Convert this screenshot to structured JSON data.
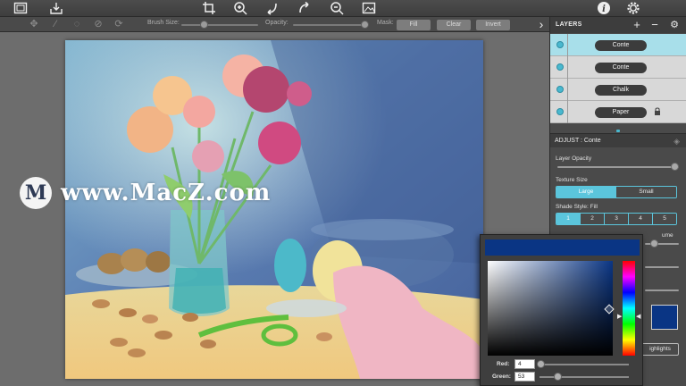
{
  "toolbar": {
    "buttons": [
      {
        "name": "gallery-icon",
        "glyph": "▣"
      },
      {
        "name": "save-tray-icon",
        "glyph": "⇩"
      },
      {
        "name": "crop-icon",
        "glyph": "⌗"
      },
      {
        "name": "zoom-in-icon",
        "glyph": "⊕"
      },
      {
        "name": "undo-icon",
        "glyph": "↶"
      },
      {
        "name": "redo-icon",
        "glyph": "↷"
      },
      {
        "name": "zoom-out-icon",
        "glyph": "⊖"
      },
      {
        "name": "image-icon",
        "glyph": "▨"
      },
      {
        "name": "info-icon",
        "glyph": "i"
      },
      {
        "name": "settings-icon",
        "glyph": "⚙"
      }
    ]
  },
  "subbar": {
    "tool_glyphs": [
      "✥",
      "⁄",
      "◌",
      "⊘",
      "⟳"
    ],
    "brush_size_label": "Brush Size:",
    "brush_size_value": 0.3,
    "opacity_label": "Opacity:",
    "opacity_value": 0.97,
    "mask_label": "Mask:",
    "fill_label": "Fill",
    "clear_label": "Clear",
    "invert_label": "Invert",
    "panel_toggle_glyph": "›"
  },
  "watermark": {
    "logo_letter": "M",
    "text": "www.MacZ.com"
  },
  "layers": {
    "title": "LAYERS",
    "add_glyph": "+",
    "remove_glyph": "−",
    "options_glyph": "⚙",
    "items": [
      {
        "label": "Conte",
        "selected": true,
        "locked": false
      },
      {
        "label": "Conte",
        "selected": false,
        "locked": false
      },
      {
        "label": "Chalk",
        "selected": false,
        "locked": false
      },
      {
        "label": "Paper",
        "selected": false,
        "locked": true
      }
    ],
    "lock_glyph": "🔒"
  },
  "adjust": {
    "title": "ADJUST : Conte",
    "layer_opacity_label": "Layer Opacity",
    "layer_opacity_value": 0.97,
    "texture_size_label": "Texture Size",
    "texture_options": [
      "Large",
      "Small"
    ],
    "texture_selected": 0,
    "shade_style_label": "Shade Style: Fill",
    "shade_options": [
      "1",
      "2",
      "3",
      "4",
      "5"
    ],
    "shade_selected": 0,
    "partial_label": "ume",
    "highlights_label": "ighlights"
  },
  "color_picker": {
    "color": "#0a3584",
    "red_label": "Red:",
    "red_value": "4",
    "red_fraction": 0.02,
    "green_label": "Green:",
    "green_value": "53",
    "green_fraction": 0.21
  }
}
